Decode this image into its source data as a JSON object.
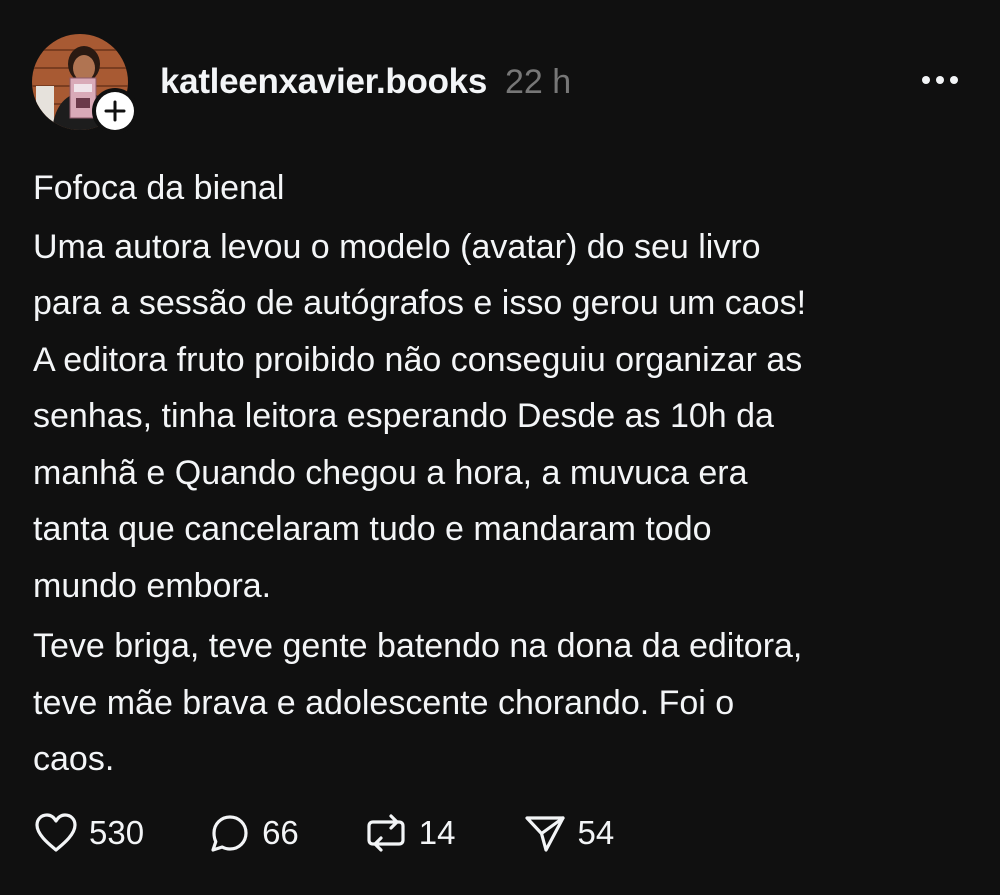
{
  "post": {
    "author": {
      "username": "katleenxavier.books"
    },
    "time_ago": "22 h",
    "body": {
      "title": "Fofoca da bienal",
      "paragraph_1_lines": [
        "Uma autora levou o modelo (avatar) do seu livro",
        "para a sessão de autógrafos e isso gerou um caos!",
        "A editora fruto proibido não conseguiu organizar as",
        "senhas, tinha leitora esperando Desde as 10h da",
        "manhã e Quando chegou a hora, a muvuca era",
        "tanta que cancelaram tudo e mandaram todo",
        "mundo embora."
      ],
      "paragraph_2_lines": [
        "Teve briga, teve gente batendo na dona da editora,",
        "teve mãe brava e adolescente chorando. Foi o",
        "caos."
      ]
    },
    "stats": {
      "likes": "530",
      "replies": "66",
      "reposts": "14",
      "shares": "54"
    }
  },
  "icons": {
    "like": "heart-icon",
    "reply": "comment-bubble-icon",
    "repost": "repost-icon",
    "share": "send-icon",
    "more": "more-dots-icon",
    "follow": "plus-icon"
  },
  "colors": {
    "background": "#101010",
    "text": "#f3f5f7",
    "muted": "#777777",
    "badge": "#ffffff"
  }
}
